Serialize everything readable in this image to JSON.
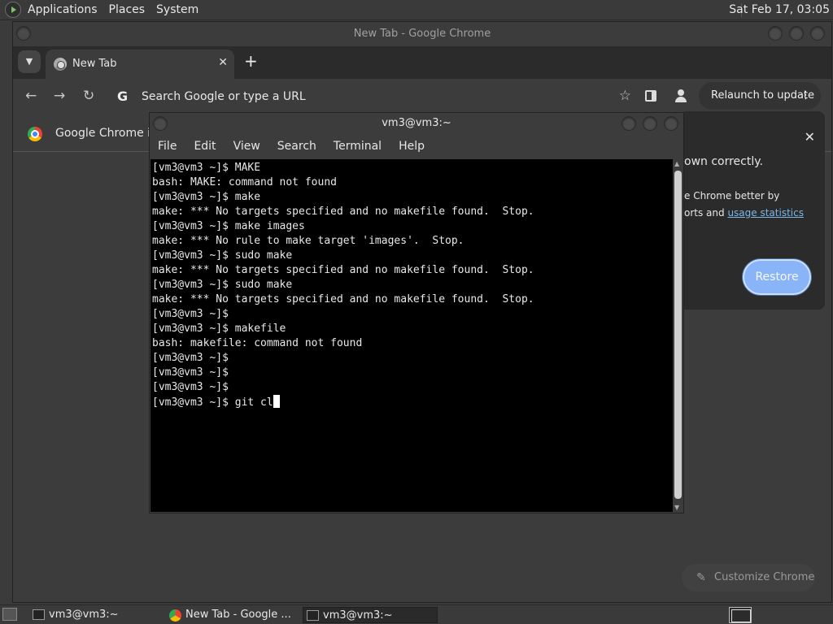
{
  "top_panel": {
    "menus": [
      "Applications",
      "Places",
      "System"
    ],
    "clock": "Sat Feb 17, 03:05"
  },
  "chrome": {
    "window_title": "New Tab - Google Chrome",
    "tab_label": "New Tab",
    "tab_close": "✕",
    "new_tab": "+",
    "omnibox_placeholder": "Search Google or type a URL",
    "omnibox_g": "G",
    "relaunch_label": "Relaunch to update",
    "relaunch_menu": "⋮",
    "infobar_text": "Google Chrome isn",
    "restore_panel": {
      "close": "✕",
      "line1": "own correctly.",
      "line2": "e Chrome better by",
      "line3_text": "orts and ",
      "line3_link": "usage statistics",
      "restore_label": "Restore"
    },
    "customize_label": "Customize Chrome"
  },
  "terminal": {
    "title": "vm3@vm3:~",
    "menus": [
      "File",
      "Edit",
      "View",
      "Search",
      "Terminal",
      "Help"
    ],
    "lines": [
      "[vm3@vm3 ~]$ MAKE",
      "bash: MAKE: command not found",
      "[vm3@vm3 ~]$ make",
      "make: *** No targets specified and no makefile found.  Stop.",
      "[vm3@vm3 ~]$ make images",
      "make: *** No rule to make target 'images'.  Stop.",
      "[vm3@vm3 ~]$ sudo make",
      "make: *** No targets specified and no makefile found.  Stop.",
      "[vm3@vm3 ~]$ sudo make",
      "make: *** No targets specified and no makefile found.  Stop.",
      "[vm3@vm3 ~]$",
      "[vm3@vm3 ~]$ makefile",
      "bash: makefile: command not found",
      "[vm3@vm3 ~]$",
      "[vm3@vm3 ~]$",
      "[vm3@vm3 ~]$"
    ],
    "current_input": "[vm3@vm3 ~]$ git cl"
  },
  "taskbar": {
    "items": [
      "vm3@vm3:~",
      "New Tab - Google ...",
      "vm3@vm3:~"
    ]
  },
  "colors": {
    "accent": "#8ab4f8",
    "link": "#7ab7e8",
    "terminal_bg": "#000000"
  }
}
